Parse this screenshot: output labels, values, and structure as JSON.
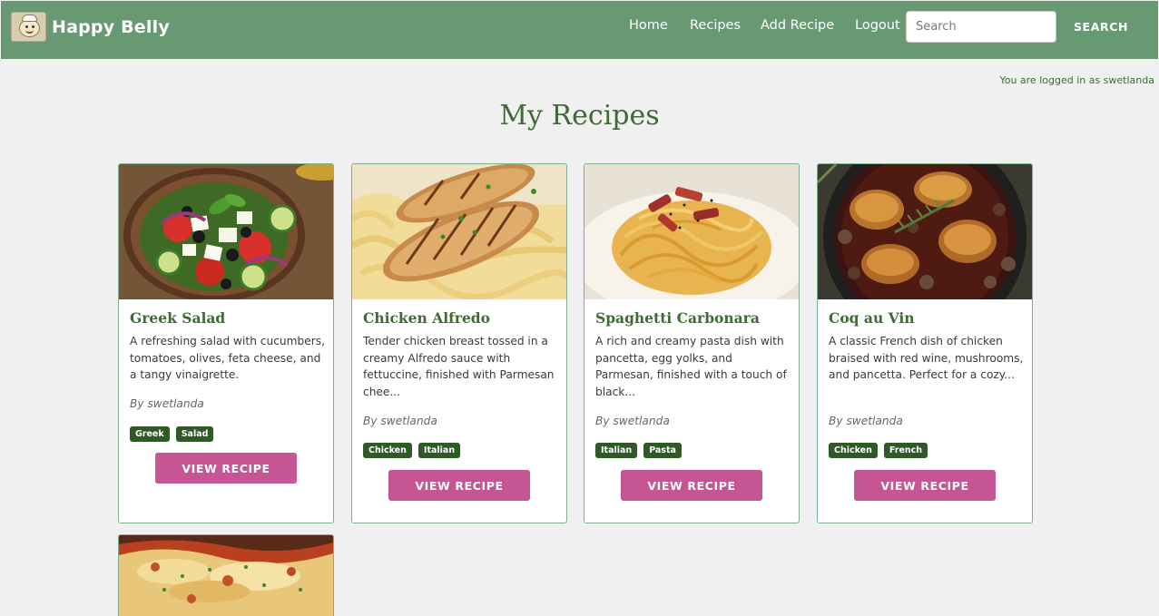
{
  "app": {
    "name": "Happy Belly",
    "logo_icon": "chef-mascot-logo-icon"
  },
  "colors": {
    "navbar": "#679a72",
    "accent_green": "#3e6b34",
    "tag_bg": "#2f5a28",
    "button_pink": "#c65693",
    "page_bg": "#f0f0f0"
  },
  "nav": {
    "links": [
      {
        "label": "Home"
      },
      {
        "label": "Recipes"
      },
      {
        "label": "Add Recipe"
      },
      {
        "label": "Logout"
      }
    ],
    "search": {
      "placeholder": "Search",
      "value": "",
      "button_label": "SEARCH"
    }
  },
  "status": {
    "logged_in_text": "You are logged in as swetlanda"
  },
  "main": {
    "title": "My Recipes",
    "recipes": [
      {
        "title": "Greek Salad",
        "description": "A refreshing salad with cucumbers, tomatoes, olives, feta cheese, and a tangy vinaigrette.",
        "author": "By swetlanda",
        "tags": [
          "Greek",
          "Salad"
        ],
        "button_label": "VIEW RECIPE",
        "image": "greek-salad-photo"
      },
      {
        "title": "Chicken Alfredo",
        "description": "Tender chicken breast tossed in a creamy Alfredo sauce with fettuccine, finished with Parmesan chee...",
        "author": "By swetlanda",
        "tags": [
          "Chicken",
          "Italian"
        ],
        "button_label": "VIEW RECIPE",
        "image": "chicken-alfredo-photo"
      },
      {
        "title": "Spaghetti Carbonara",
        "description": "A rich and creamy pasta dish with pancetta, egg yolks, and Parmesan, finished with a touch of black...",
        "author": "By swetlanda",
        "tags": [
          "Italian",
          "Pasta"
        ],
        "button_label": "VIEW RECIPE",
        "image": "spaghetti-carbonara-photo"
      },
      {
        "title": "Coq au Vin",
        "description": "A classic French dish of chicken braised with red wine, mushrooms, and pancetta. Perfect for a cozy...",
        "author": "By swetlanda",
        "tags": [
          "Chicken",
          "French"
        ],
        "button_label": "VIEW RECIPE",
        "image": "coq-au-vin-photo"
      },
      {
        "image": "lasagna-photo"
      }
    ]
  }
}
